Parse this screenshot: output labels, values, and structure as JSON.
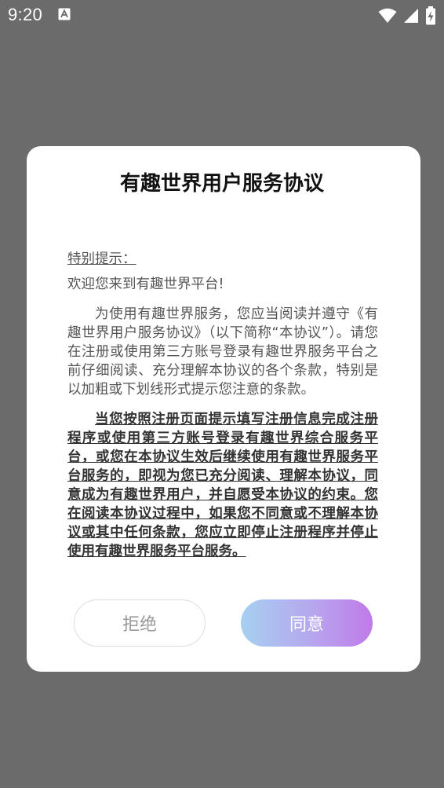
{
  "status_bar": {
    "time": "9:20",
    "notification_icon": "a-notification-icon",
    "wifi_icon": "wifi-icon",
    "signal_icon": "signal-icon",
    "battery_icon": "battery-charging-icon"
  },
  "dialog": {
    "title": "有趣世界用户服务协议",
    "tip": "特别提示：",
    "welcome": "欢迎您来到有趣世界平台!",
    "paragraph1": "为使用有趣世界服务，您应当阅读并遵守《有趣世界用户服务协议》（以下简称“本协议”）。请您在注册或使用第三方账号登录有趣世界服务平台之前仔细阅读、充分理解本协议的各个条款，特别是以加粗或下划线形式提示您注意的条款。",
    "paragraph2": "当您按照注册页面提示填写注册信息完成注册程序或使用第三方账号登录有趣世界综合服务平台，或您在本协议生效后继续使用有趣世界服务平台服务的，即视为您已充分阅读、理解本协议，同意成为有趣世界用户，并自愿受本协议的约束。您在阅读本协议过程中，如果您不同意或不理解本协议或其中任何条款，您应立即停止注册程序并停止使用有趣世界服务平台服务。",
    "reject_label": "拒绝",
    "agree_label": "同意"
  },
  "colors": {
    "overlay": "#6b6b6b",
    "agree_gradient_start": "#a6d0f1",
    "agree_gradient_end": "#c07ae9"
  }
}
